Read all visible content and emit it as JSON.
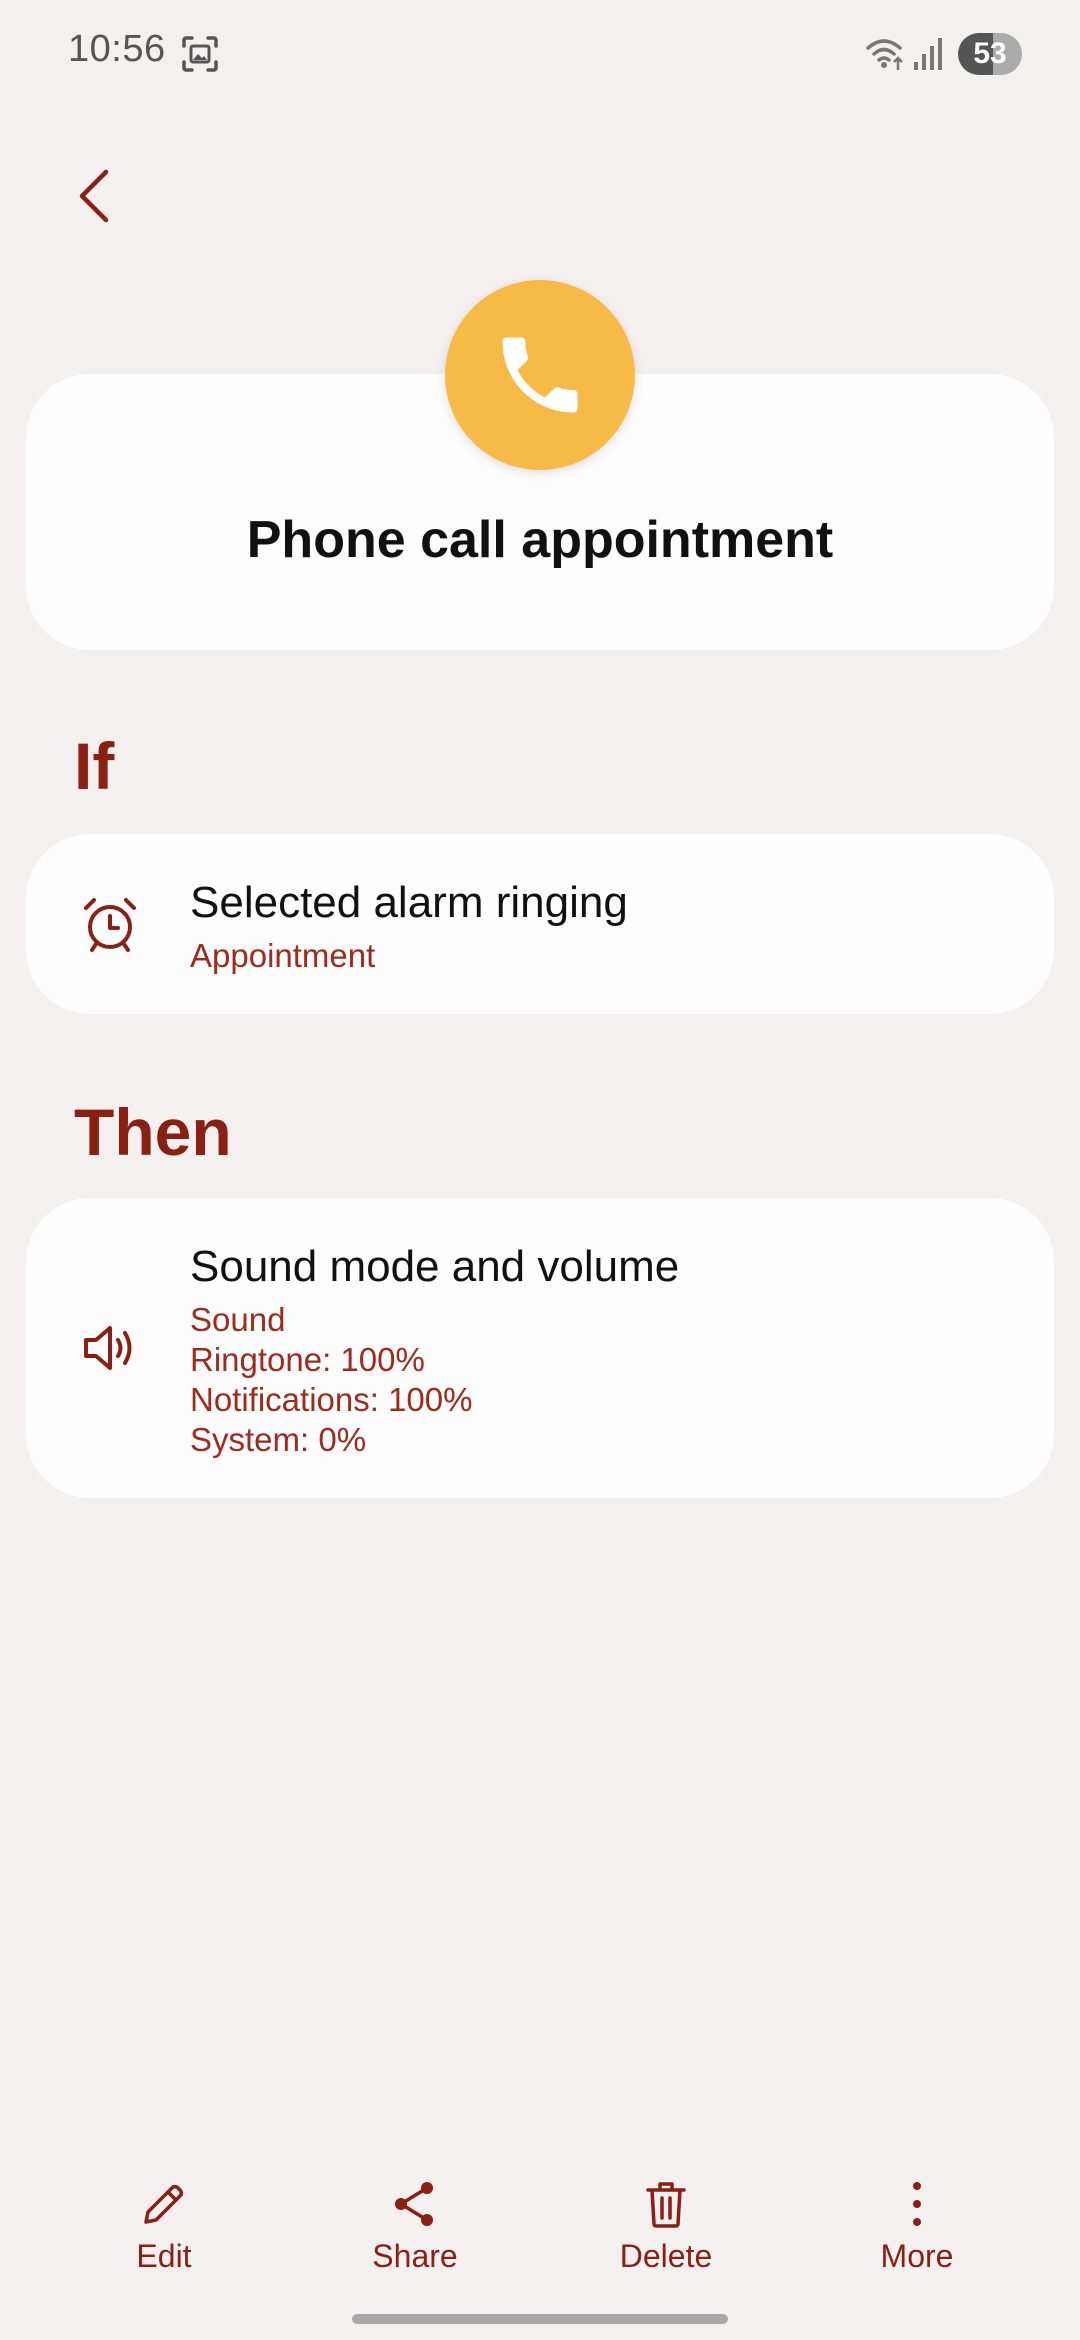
{
  "status_bar": {
    "time": "10:56",
    "battery_level": "53",
    "icons": [
      "screenshot-icon",
      "wifi-icon",
      "signal-icon",
      "battery-icon"
    ]
  },
  "colors": {
    "background": "#f4f0f0",
    "card": "#fdfdfd",
    "accent": "#8a1f12",
    "subtext": "#a02a1c",
    "header_icon_bg": "#f8ba47"
  },
  "header": {
    "icon": "phone-icon",
    "title": "Phone call appointment"
  },
  "if_section": {
    "label": "If",
    "condition": {
      "icon": "alarm-clock-icon",
      "title": "Selected alarm ringing",
      "subtitle": "Appointment"
    }
  },
  "then_section": {
    "label": "Then",
    "action": {
      "icon": "speaker-icon",
      "title": "Sound mode and volume",
      "details": [
        "Sound",
        "Ringtone: 100%",
        "Notifications: 100%",
        "System: 0%"
      ]
    }
  },
  "bottom_bar": {
    "edit_label": "Edit",
    "share_label": "Share",
    "delete_label": "Delete",
    "more_label": "More"
  }
}
